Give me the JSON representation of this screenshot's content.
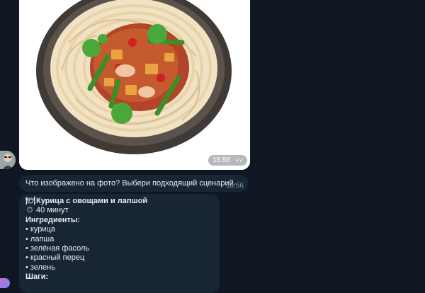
{
  "messages": {
    "photo_time": "18:56",
    "question": {
      "text": "Что изображено на фото? Выбери подходящий сценарий.",
      "time": "18:56"
    },
    "recipe": {
      "title_icon": "plate-icon",
      "title": "Курица с овощами и лапшой",
      "time_icon": "timer-icon",
      "time": "40 минут",
      "ingredients_label": "Ингредиенты:",
      "ingredients": [
        "• курица",
        "• лапша",
        "• зелёная фасоль",
        "• красный перец",
        "• зелень"
      ],
      "steps_label": "Шаги:"
    }
  },
  "colors": {
    "background": "#0f1722",
    "bubble": "#182533",
    "time_text": "#8c9aaa"
  }
}
